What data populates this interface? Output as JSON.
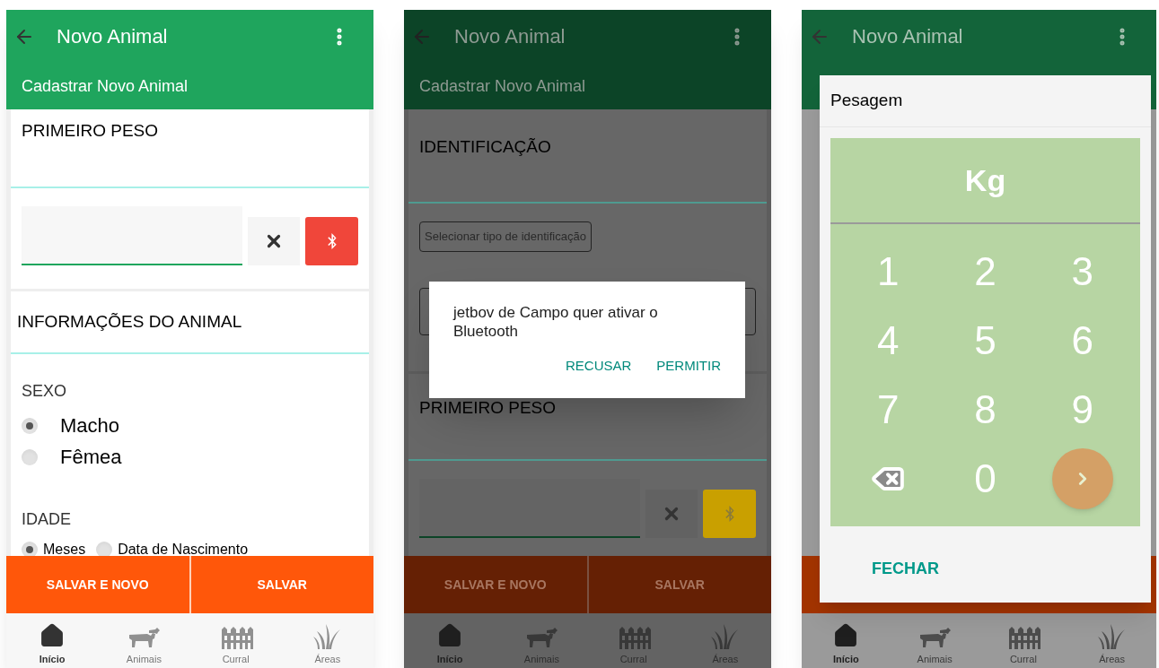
{
  "screens": [
    {
      "kind": "form",
      "app_bar": {
        "title": "Novo Animal",
        "subtitle": "Cadastrar Novo Animal"
      },
      "sections": [
        {
          "kind": "weight",
          "title": "PRIMEIRO PESO",
          "connecting": false
        },
        {
          "kind": "info",
          "title": "INFORMAÇÕES DO ANIMAL",
          "groups": [
            {
              "label": "SEXO",
              "kind": "stacked",
              "options": [
                {
                  "label": "Macho",
                  "selected": true
                },
                {
                  "label": "Fêmea",
                  "selected": false
                }
              ]
            },
            {
              "label": "IDADE",
              "kind": "inline",
              "options": [
                {
                  "label": "Meses",
                  "selected": true
                },
                {
                  "label": "Data de Nascimento",
                  "selected": false
                }
              ]
            }
          ]
        }
      ],
      "actions": [
        "SALVAR E NOVO",
        "SALVAR"
      ],
      "nav": [
        {
          "label": "Início",
          "selected": true
        },
        {
          "label": "Animais",
          "selected": false
        },
        {
          "label": "Curral",
          "selected": false
        },
        {
          "label": "Áreas",
          "selected": false
        }
      ]
    },
    {
      "kind": "dimmed",
      "app_bar": {
        "title": "Novo Animal",
        "subtitle": "Cadastrar Novo Animal"
      },
      "sections": [
        {
          "kind": "identification",
          "title": "IDENTIFICAÇÃO",
          "select_label": "Selecionar tipo de identificação"
        },
        {
          "kind": "weight",
          "title": "PRIMEIRO PESO",
          "connecting": true
        }
      ],
      "actions": [
        "SALVAR E NOVO",
        "SALVAR"
      ],
      "nav": [
        {
          "label": "Início",
          "selected": true
        },
        {
          "label": "Animais",
          "selected": false
        },
        {
          "label": "Curral",
          "selected": false
        },
        {
          "label": "Áreas",
          "selected": false
        }
      ],
      "alert": {
        "message": "jetbov de Campo quer ativar o Bluetooth",
        "buttons": [
          "RECUSAR",
          "PERMITIR"
        ]
      }
    },
    {
      "kind": "veiled",
      "app_bar": {
        "title": "Novo Animal"
      },
      "nav": [
        {
          "label": "Início",
          "selected": true
        },
        {
          "label": "Animais",
          "selected": false
        },
        {
          "label": "Curral",
          "selected": false
        },
        {
          "label": "Áreas",
          "selected": false
        }
      ],
      "keypad_dialog": {
        "title": "Pesagem",
        "display": "Kg",
        "keys": [
          {
            "kind": "digit",
            "label": "1"
          },
          {
            "kind": "digit",
            "label": "2"
          },
          {
            "kind": "digit",
            "label": "3"
          },
          {
            "kind": "digit",
            "label": "4"
          },
          {
            "kind": "digit",
            "label": "5"
          },
          {
            "kind": "digit",
            "label": "6"
          },
          {
            "kind": "digit",
            "label": "7"
          },
          {
            "kind": "digit",
            "label": "8"
          },
          {
            "kind": "digit",
            "label": "9"
          },
          {
            "kind": "backspace"
          },
          {
            "kind": "digit",
            "label": "0"
          },
          {
            "kind": "next"
          }
        ],
        "close_label": "FECHAR"
      }
    }
  ]
}
